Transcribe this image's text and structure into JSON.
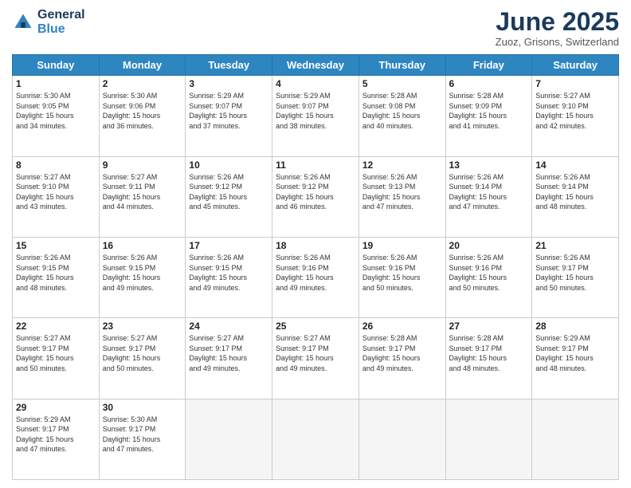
{
  "header": {
    "logo_line1": "General",
    "logo_line2": "Blue",
    "month_title": "June 2025",
    "location": "Zuoz, Grisons, Switzerland"
  },
  "weekdays": [
    "Sunday",
    "Monday",
    "Tuesday",
    "Wednesday",
    "Thursday",
    "Friday",
    "Saturday"
  ],
  "days": [
    {
      "num": "",
      "info": ""
    },
    {
      "num": "",
      "info": ""
    },
    {
      "num": "",
      "info": ""
    },
    {
      "num": "",
      "info": ""
    },
    {
      "num": "",
      "info": ""
    },
    {
      "num": "",
      "info": ""
    },
    {
      "num": "7",
      "info": "Sunrise: 5:27 AM\nSunset: 9:10 PM\nDaylight: 15 hours\nand 42 minutes."
    },
    {
      "num": "8",
      "info": "Sunrise: 5:27 AM\nSunset: 9:10 PM\nDaylight: 15 hours\nand 43 minutes."
    },
    {
      "num": "9",
      "info": "Sunrise: 5:27 AM\nSunset: 9:11 PM\nDaylight: 15 hours\nand 44 minutes."
    },
    {
      "num": "10",
      "info": "Sunrise: 5:26 AM\nSunset: 9:12 PM\nDaylight: 15 hours\nand 45 minutes."
    },
    {
      "num": "11",
      "info": "Sunrise: 5:26 AM\nSunset: 9:12 PM\nDaylight: 15 hours\nand 46 minutes."
    },
    {
      "num": "12",
      "info": "Sunrise: 5:26 AM\nSunset: 9:13 PM\nDaylight: 15 hours\nand 47 minutes."
    },
    {
      "num": "13",
      "info": "Sunrise: 5:26 AM\nSunset: 9:14 PM\nDaylight: 15 hours\nand 47 minutes."
    },
    {
      "num": "14",
      "info": "Sunrise: 5:26 AM\nSunset: 9:14 PM\nDaylight: 15 hours\nand 48 minutes."
    },
    {
      "num": "15",
      "info": "Sunrise: 5:26 AM\nSunset: 9:15 PM\nDaylight: 15 hours\nand 48 minutes."
    },
    {
      "num": "16",
      "info": "Sunrise: 5:26 AM\nSunset: 9:15 PM\nDaylight: 15 hours\nand 49 minutes."
    },
    {
      "num": "17",
      "info": "Sunrise: 5:26 AM\nSunset: 9:15 PM\nDaylight: 15 hours\nand 49 minutes."
    },
    {
      "num": "18",
      "info": "Sunrise: 5:26 AM\nSunset: 9:16 PM\nDaylight: 15 hours\nand 49 minutes."
    },
    {
      "num": "19",
      "info": "Sunrise: 5:26 AM\nSunset: 9:16 PM\nDaylight: 15 hours\nand 50 minutes."
    },
    {
      "num": "20",
      "info": "Sunrise: 5:26 AM\nSunset: 9:16 PM\nDaylight: 15 hours\nand 50 minutes."
    },
    {
      "num": "21",
      "info": "Sunrise: 5:26 AM\nSunset: 9:17 PM\nDaylight: 15 hours\nand 50 minutes."
    },
    {
      "num": "22",
      "info": "Sunrise: 5:27 AM\nSunset: 9:17 PM\nDaylight: 15 hours\nand 50 minutes."
    },
    {
      "num": "23",
      "info": "Sunrise: 5:27 AM\nSunset: 9:17 PM\nDaylight: 15 hours\nand 50 minutes."
    },
    {
      "num": "24",
      "info": "Sunrise: 5:27 AM\nSunset: 9:17 PM\nDaylight: 15 hours\nand 49 minutes."
    },
    {
      "num": "25",
      "info": "Sunrise: 5:27 AM\nSunset: 9:17 PM\nDaylight: 15 hours\nand 49 minutes."
    },
    {
      "num": "26",
      "info": "Sunrise: 5:28 AM\nSunset: 9:17 PM\nDaylight: 15 hours\nand 49 minutes."
    },
    {
      "num": "27",
      "info": "Sunrise: 5:28 AM\nSunset: 9:17 PM\nDaylight: 15 hours\nand 48 minutes."
    },
    {
      "num": "28",
      "info": "Sunrise: 5:29 AM\nSunset: 9:17 PM\nDaylight: 15 hours\nand 48 minutes."
    },
    {
      "num": "29",
      "info": "Sunrise: 5:29 AM\nSunset: 9:17 PM\nDaylight: 15 hours\nand 47 minutes."
    },
    {
      "num": "30",
      "info": "Sunrise: 5:30 AM\nSunset: 9:17 PM\nDaylight: 15 hours\nand 47 minutes."
    },
    {
      "num": "",
      "info": ""
    },
    {
      "num": "",
      "info": ""
    },
    {
      "num": "",
      "info": ""
    },
    {
      "num": "",
      "info": ""
    },
    {
      "num": "",
      "info": ""
    }
  ],
  "row1": [
    {
      "num": "1",
      "info": "Sunrise: 5:30 AM\nSunset: 9:05 PM\nDaylight: 15 hours\nand 34 minutes."
    },
    {
      "num": "2",
      "info": "Sunrise: 5:30 AM\nSunset: 9:06 PM\nDaylight: 15 hours\nand 36 minutes."
    },
    {
      "num": "3",
      "info": "Sunrise: 5:29 AM\nSunset: 9:07 PM\nDaylight: 15 hours\nand 37 minutes."
    },
    {
      "num": "4",
      "info": "Sunrise: 5:29 AM\nSunset: 9:07 PM\nDaylight: 15 hours\nand 38 minutes."
    },
    {
      "num": "5",
      "info": "Sunrise: 5:28 AM\nSunset: 9:08 PM\nDaylight: 15 hours\nand 40 minutes."
    },
    {
      "num": "6",
      "info": "Sunrise: 5:28 AM\nSunset: 9:09 PM\nDaylight: 15 hours\nand 41 minutes."
    },
    {
      "num": "7",
      "info": "Sunrise: 5:27 AM\nSunset: 9:10 PM\nDaylight: 15 hours\nand 42 minutes."
    }
  ]
}
